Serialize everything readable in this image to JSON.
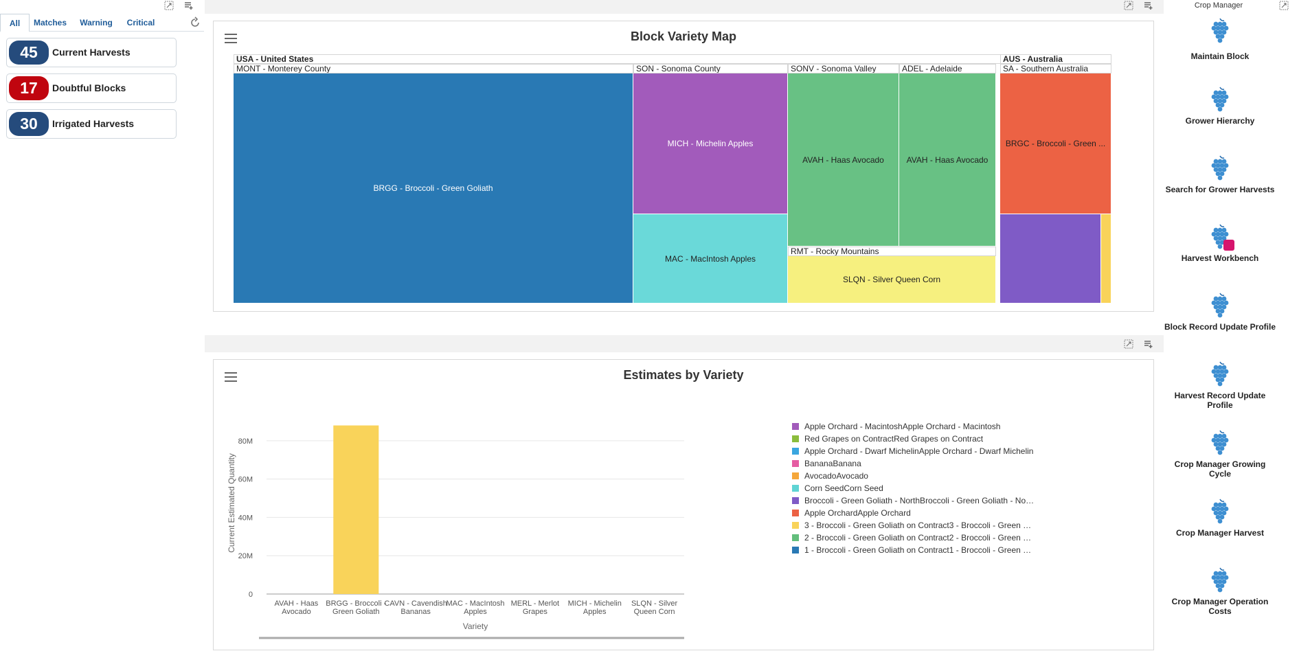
{
  "left": {
    "tabs": [
      "All",
      "Matches",
      "Warning",
      "Critical"
    ],
    "kpis": [
      {
        "value": "45",
        "label": "Current Harvests",
        "color": "#254b7c"
      },
      {
        "value": "17",
        "label": "Doubtful Blocks",
        "color": "#c0050f"
      },
      {
        "value": "30",
        "label": "Irrigated Harvests",
        "color": "#254b7c"
      }
    ]
  },
  "treemap": {
    "title": "Block Variety Map",
    "usa": "USA - United States",
    "aus": "AUS - Australia",
    "mont": "MONT - Monterey County",
    "son": "SON - Sonoma County",
    "sonv": "SONV - Sonoma Valley",
    "adel": "ADEL - Adelaide",
    "rmt": "RMT - Rocky Mountains",
    "sa": "SA - Southern Australia",
    "brgg": "BRGG - Broccoli - Green Goliath",
    "mich": "MICH - Michelin Apples",
    "mac": "MAC - MacIntosh Apples",
    "avah1": "AVAH - Haas Avocado",
    "avah2": "AVAH - Haas Avocado",
    "slqn": "SLQN - Silver Queen Corn",
    "brgc": "BRGC - Broccoli - Green ..."
  },
  "chart": {
    "title": "Estimates by Variety"
  },
  "chart_data": {
    "type": "bar",
    "title": "Estimates by Variety",
    "xlabel": "Variety",
    "ylabel": "Current Estimated Quantity",
    "categories": [
      [
        "AVAH - Haas",
        "Avocado"
      ],
      [
        "BRGG - Broccoli -",
        "Green Goliath"
      ],
      [
        "CAVN - Cavendish",
        "Bananas"
      ],
      [
        "MAC - MacIntosh",
        "Apples"
      ],
      [
        "MERL - Merlot",
        "Grapes"
      ],
      [
        "MICH - Michelin",
        "Apples"
      ],
      [
        "SLQN - Silver",
        "Queen Corn"
      ]
    ],
    "yticks": [
      "0",
      "20M",
      "40M",
      "60M",
      "80M"
    ],
    "ylim": [
      0,
      95000000
    ],
    "series": [
      {
        "name": "Apple Orchard - MacintoshApple Orchard - Macintosh",
        "color": "#a25bbb",
        "values": [
          0,
          0,
          0,
          0,
          0,
          0,
          0
        ]
      },
      {
        "name": "Red Grapes on ContractRed Grapes on Contract",
        "color": "#8bbd3c",
        "values": [
          0,
          0,
          0,
          0,
          0,
          0,
          0
        ]
      },
      {
        "name": "Apple Orchard - Dwarf MichelinApple Orchard - Dwarf Michelin",
        "color": "#3aa6df",
        "values": [
          0,
          0,
          0,
          0,
          0,
          0,
          0
        ]
      },
      {
        "name": "BananaBanana",
        "color": "#e55da3",
        "values": [
          0,
          0,
          0,
          0,
          0,
          0,
          0
        ]
      },
      {
        "name": "AvocadoAvocado",
        "color": "#f5a73b",
        "values": [
          0,
          0,
          0,
          0,
          0,
          0,
          0
        ]
      },
      {
        "name": "Corn SeedCorn Seed",
        "color": "#5fd4d4",
        "values": [
          0,
          0,
          0,
          0,
          0,
          0,
          0
        ]
      },
      {
        "name": "Broccoli - Green Goliath - NorthBroccoli - Green Goliath - North",
        "color": "#7f5bc6",
        "values": [
          0,
          0,
          0,
          0,
          0,
          0,
          0
        ]
      },
      {
        "name": "Apple OrchardApple Orchard",
        "color": "#ec6244",
        "values": [
          0,
          0,
          0,
          0,
          0,
          0,
          0
        ]
      },
      {
        "name": "3 - Broccoli - Green Goliath on Contract3 - Broccoli - Green Goliath on Contract",
        "color": "#f9d35a",
        "values": [
          0,
          88000000,
          0,
          0,
          0,
          0,
          0
        ]
      },
      {
        "name": "2 - Broccoli - Green Goliath on Contract2 - Broccoli - Green Goliath on Contract",
        "color": "#63be7c",
        "values": [
          0,
          0,
          0,
          0,
          0,
          0,
          0
        ]
      },
      {
        "name": "1 - Broccoli - Green Goliath on Contract1 - Broccoli - Green Goliath on Contract",
        "color": "#2979b4",
        "values": [
          0,
          0,
          0,
          0,
          0,
          0,
          0
        ]
      }
    ],
    "legend_position": "right",
    "grid": true
  },
  "right": {
    "title": "Crop Manager",
    "items": [
      {
        "label": "Maintain Block"
      },
      {
        "label": "Grower Hierarchy"
      },
      {
        "label": "Search for Grower Harvests"
      },
      {
        "label": "Harvest Workbench"
      },
      {
        "label": "Block Record Update Profile"
      },
      {
        "label": "Harvest Record Update Profile"
      },
      {
        "label": "Crop Manager Growing Cycle"
      },
      {
        "label": "Crop Manager Harvest"
      },
      {
        "label": "Crop Manager Operation Costs"
      }
    ]
  },
  "icons": {
    "expand": "expand-icon",
    "add": "add-to-list-icon",
    "refresh": "refresh-icon",
    "menu": "hamburger-menu-icon",
    "grapes": "grapes-icon",
    "briefcase": "briefcase-icon"
  }
}
